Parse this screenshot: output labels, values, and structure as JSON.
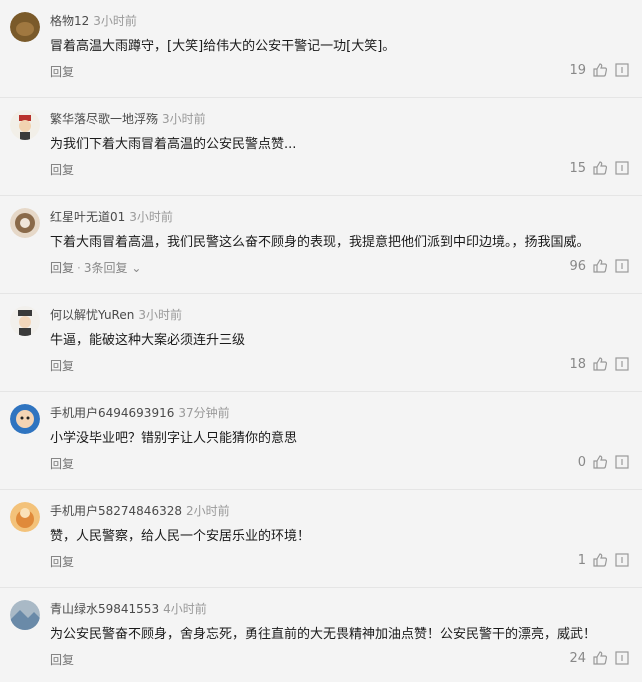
{
  "comments": [
    {
      "user": "格物12",
      "time": "3小时前",
      "text": "冒着高温大雨蹲守，[大笑]给伟大的公安干警记一功[大笑]。",
      "reply": "回复",
      "likes": "19",
      "avatar_color": "#7a5a2a"
    },
    {
      "user": "繁华落尽歌一地浮殇",
      "time": "3小时前",
      "text": "为我们下着大雨冒着高温的公安民警点赞...",
      "reply": "回复",
      "likes": "15",
      "avatar_color": "#b8322c"
    },
    {
      "user": "红星叶无道01",
      "time": "3小时前",
      "text": "下着大雨冒着高温，我们民警这么奋不顾身的表现，我提意把他们派到中印边境。，扬我国威。",
      "reply": "回复",
      "replies": "3条回复",
      "likes": "96",
      "avatar_color": "#8a6a4a"
    },
    {
      "user": "何以解忧YuRen",
      "time": "3小时前",
      "text": "牛逼，能破这种大案必须连升三级",
      "reply": "回复",
      "likes": "18",
      "avatar_color": "#3a3a3a"
    },
    {
      "user": "手机用户6494693916",
      "time": "37分钟前",
      "text": "小学没毕业吧？错别字让人只能猜你的意思",
      "reply": "回复",
      "likes": "0",
      "avatar_color": "#2f74c0"
    },
    {
      "user": "手机用户58274846328",
      "time": "2小时前",
      "text": "赞，人民警察，给人民一个安居乐业的环境！",
      "reply": "回复",
      "likes": "1",
      "avatar_color": "#e08a3a"
    },
    {
      "user": "青山绿水59841553",
      "time": "4小时前",
      "text": "为公安民警奋不顾身，舍身忘死，勇往直前的大无畏精神加油点赞！公安民警干的漂亮，威武！",
      "reply": "回复",
      "likes": "24",
      "avatar_color": "#6a8aa8"
    }
  ],
  "icons": {
    "like": "thumbs-up-icon",
    "more": "comment-box-icon",
    "expand": "chevron-down-icon"
  }
}
